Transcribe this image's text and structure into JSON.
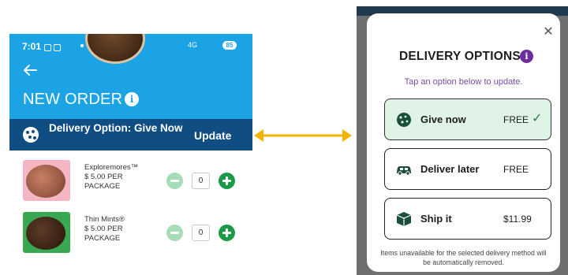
{
  "left_screen": {
    "status_time": "7:01",
    "battery_level": "85",
    "network": "4G",
    "page_title": "NEW ORDER",
    "delivery_bar": {
      "label": "Delivery Option: Give Now",
      "update_label": "Update"
    },
    "products": [
      {
        "name": "Exploremores™",
        "price": "$ 5.00 PER PACKAGE",
        "quantity": "0"
      },
      {
        "name": "Thin Mints®",
        "price": "$ 5.00 PER PACKAGE",
        "quantity": "0"
      }
    ]
  },
  "connector": {
    "color": "#f5b400"
  },
  "right_screen": {
    "modal_title": "DELIVERY OPTIONS",
    "modal_subtitle": "Tap an option below to update.",
    "options": [
      {
        "label": "Give now",
        "price": "FREE",
        "selected": true,
        "icon": "cookie-icon"
      },
      {
        "label": "Deliver later",
        "price": "FREE",
        "selected": false,
        "icon": "car-icon"
      },
      {
        "label": "Ship it",
        "price": "$11.99",
        "selected": false,
        "icon": "box-icon"
      }
    ],
    "footer_note": "Items unavailable for the selected delivery method will be automatically removed."
  },
  "colors": {
    "header_blue": "#1ba3e6",
    "bar_navy": "#0f4d83",
    "selected_green": "#dff3e6",
    "accent_purple": "#6e2c9c",
    "plus_green": "#1a9a47"
  }
}
